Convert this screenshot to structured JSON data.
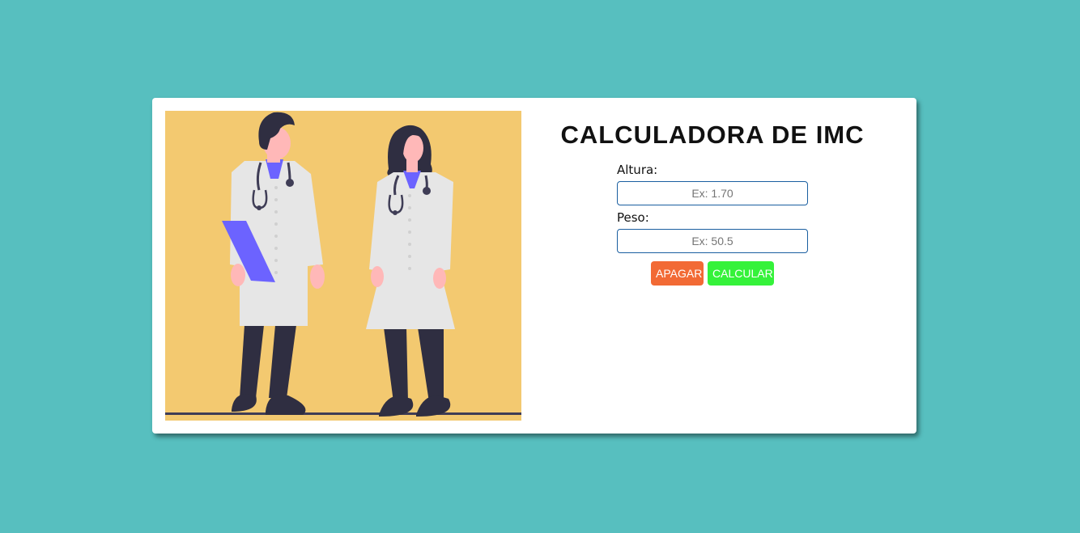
{
  "calculator": {
    "title": "CALCULADORA DE IMC",
    "height_label": "Altura:",
    "height_placeholder": "Ex: 1.70",
    "weight_label": "Peso:",
    "weight_placeholder": "Ex: 50.5",
    "clear_button": "APAGAR",
    "calculate_button": "CALCULAR"
  },
  "colors": {
    "page_background": "#57bfbf",
    "illustration_background": "#f3c970",
    "clear_button": "#f26a35",
    "calculate_button": "#35f23a",
    "input_border": "#1a5fa0"
  }
}
